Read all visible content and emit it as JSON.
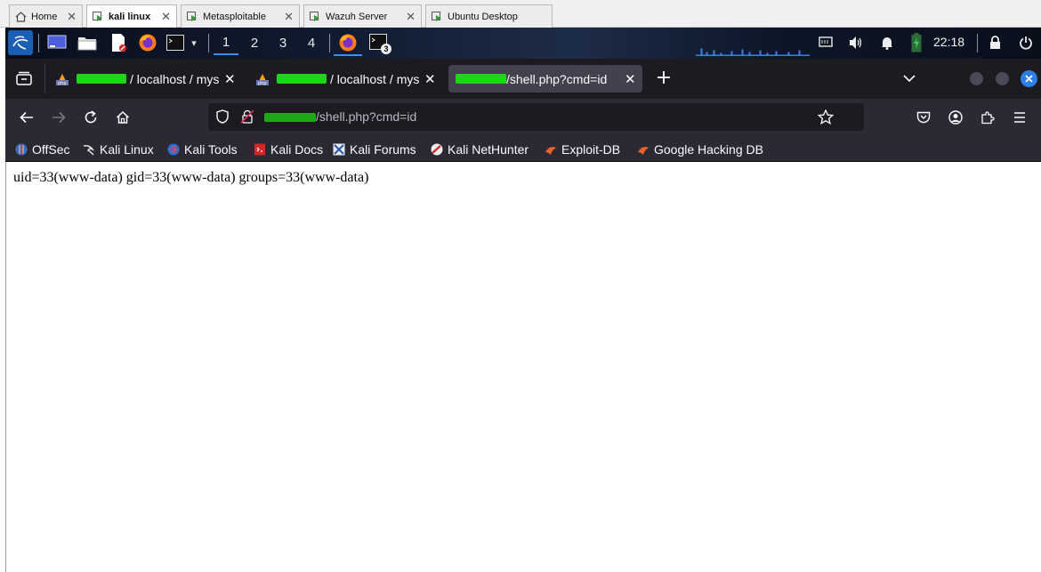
{
  "vm_tabs": [
    {
      "label": "Home",
      "icon": "home-icon",
      "active": false
    },
    {
      "label": "kali linux",
      "icon": "vm-icon",
      "active": true
    },
    {
      "label": "Metasploitable",
      "icon": "vm-icon",
      "active": false
    },
    {
      "label": "Wazuh Server",
      "icon": "vm-icon",
      "active": false
    },
    {
      "label": "Ubuntu Desktop",
      "icon": "vm-icon",
      "active": false
    }
  ],
  "panel": {
    "workspaces": [
      "1",
      "2",
      "3",
      "4"
    ],
    "active_workspace": "1",
    "terminal_badge": "3",
    "clock": "22:18"
  },
  "browser_tabs": [
    {
      "title": "/ localhost / mys",
      "masked_prefix": true,
      "active": false
    },
    {
      "title": "/ localhost / mys",
      "masked_prefix": true,
      "active": false
    },
    {
      "title": "/shell.php?cmd=id",
      "masked_prefix": true,
      "active": true
    }
  ],
  "url": {
    "path": "/shell.php?cmd=id"
  },
  "bookmarks": [
    {
      "label": "OffSec",
      "icon": "offsec-icon"
    },
    {
      "label": "Kali Linux",
      "icon": "kali-dragon-icon"
    },
    {
      "label": "Kali Tools",
      "icon": "kali-tools-icon"
    },
    {
      "label": "Kali Docs",
      "icon": "kali-docs-icon"
    },
    {
      "label": "Kali Forums",
      "icon": "kali-forums-icon"
    },
    {
      "label": "Kali NetHunter",
      "icon": "nethunter-icon"
    },
    {
      "label": "Exploit-DB",
      "icon": "exploitdb-icon"
    },
    {
      "label": "Google Hacking DB",
      "icon": "ghdb-icon"
    }
  ],
  "page": {
    "output": "uid=33(www-data) gid=33(www-data) groups=33(www-data)"
  },
  "colors": {
    "accent": "#3b8ded",
    "redaction": "#22d31c",
    "tab_bar": "#1c1b22",
    "toolbar": "#2b2a33"
  }
}
